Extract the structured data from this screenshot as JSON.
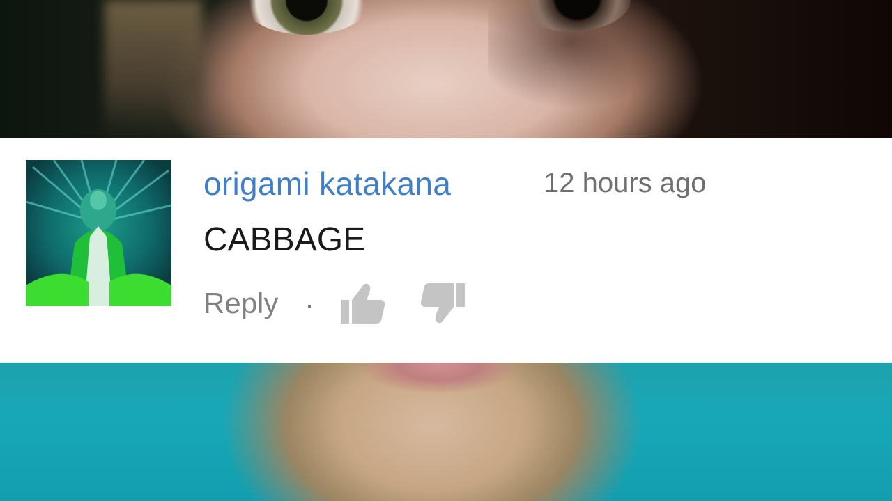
{
  "comment": {
    "author": "origami katakana",
    "timestamp": "12 hours ago",
    "text": "CABBAGE",
    "reply_label": "Reply",
    "separator": "·",
    "avatar_icon": "peacock-avatar",
    "like_icon": "thumbs-up-icon",
    "dislike_icon": "thumbs-down-icon"
  },
  "colors": {
    "author": "#3f7fc9",
    "timestamp": "#707070",
    "text": "#1a1a1a",
    "action": "#808080",
    "icon": "#c4c4c4",
    "card_background": "#ffffff",
    "shirt": "#17a8b8"
  }
}
